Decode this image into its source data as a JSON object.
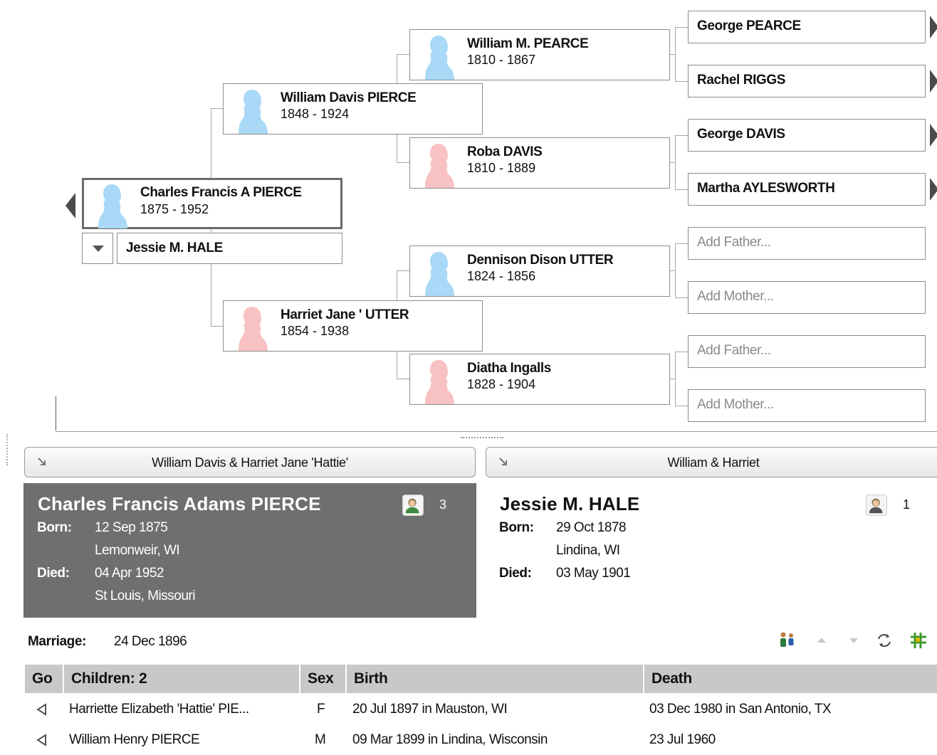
{
  "pedigree": {
    "root": {
      "name": "Charles Francis A PIERCE",
      "years": "1875 - 1952"
    },
    "spouse": {
      "name": "Jessie M. HALE"
    },
    "father": {
      "name": "William Davis PIERCE",
      "years": "1848 - 1924"
    },
    "mother": {
      "name": "Harriet Jane ' UTTER",
      "years": "1854 - 1938"
    },
    "ff": {
      "name": "William M. PEARCE",
      "years": "1810 - 1867"
    },
    "fm": {
      "name": "Roba DAVIS",
      "years": "1810 - 1889"
    },
    "mf": {
      "name": "Dennison Dison UTTER",
      "years": "1824 - 1856"
    },
    "mm": {
      "name": "Diatha Ingalls",
      "years": "1828 - 1904"
    },
    "leaves": [
      "George PEARCE",
      "Rachel RIGGS",
      "George DAVIS",
      "Martha AYLESWORTH",
      "Add Father...",
      "Add Mother...",
      "Add Father...",
      "Add Mother..."
    ]
  },
  "families": {
    "left_title": "William Davis & Harriet Jane 'Hattie'",
    "right_title": "William & Harriet"
  },
  "husband": {
    "name": "Charles Francis Adams PIERCE",
    "born_label": "Born:",
    "born_date": "12 Sep 1875",
    "born_place": "Lemonweir, WI",
    "died_label": "Died:",
    "died_date": "04 Apr 1952",
    "died_place": "St Louis, Missouri",
    "media_count": "3"
  },
  "wife": {
    "name": "Jessie M. HALE",
    "born_label": "Born:",
    "born_date": "29 Oct 1878",
    "born_place": "Lindina, WI",
    "died_label": "Died:",
    "died_date": "03 May 1901",
    "media_count": "1"
  },
  "marriage": {
    "label": "Marriage:",
    "date": "24 Dec 1896"
  },
  "children_table": {
    "headers": {
      "go": "Go",
      "children": "Children: 2",
      "sex": "Sex",
      "birth": "Birth",
      "death": "Death"
    },
    "rows": [
      {
        "name": "Harriette Elizabeth 'Hattie' PIE...",
        "sex": "F",
        "birth": "20 Jul 1897 in Mauston, WI",
        "death": "03 Dec 1980 in San Antonio, TX"
      },
      {
        "name": "William Henry PIERCE",
        "sex": "M",
        "birth": "09 Mar 1899 in Lindina, Wisconsin",
        "death": "23 Jul 1960"
      }
    ]
  },
  "colors": {
    "male": "#a9d9f7",
    "female": "#f9c2c2",
    "selected_panel": "#6f6f6f",
    "header": "#c8c8c8"
  }
}
